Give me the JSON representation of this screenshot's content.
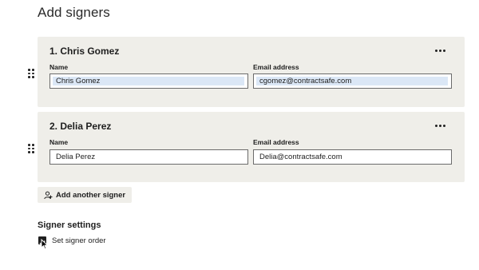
{
  "page": {
    "title": "Add signers"
  },
  "signers": [
    {
      "heading": "1. Chris Gomez",
      "name_label": "Name",
      "name_value": "Chris Gomez",
      "email_label": "Email address",
      "email_value": "cgomez@contractsafe.com",
      "selected": true
    },
    {
      "heading": "2. Delia Perez",
      "name_label": "Name",
      "name_value": "Delia Perez",
      "email_label": "Email address",
      "email_value": "Delia@contractsafe.com",
      "selected": false
    }
  ],
  "actions": {
    "add_signer_label": "Add another signer"
  },
  "settings": {
    "title": "Signer settings",
    "signer_order_label": "Set signer order",
    "signer_order_checked": true
  },
  "icons": {
    "more": "more-horizontal-icon",
    "drag": "drag-handle-icon",
    "add_user": "add-user-icon",
    "checkmark": "checkmark-icon"
  },
  "colors": {
    "card_bg": "#efeee9",
    "selection": "#dbe7f6",
    "checkbox": "#1f1f1f"
  }
}
